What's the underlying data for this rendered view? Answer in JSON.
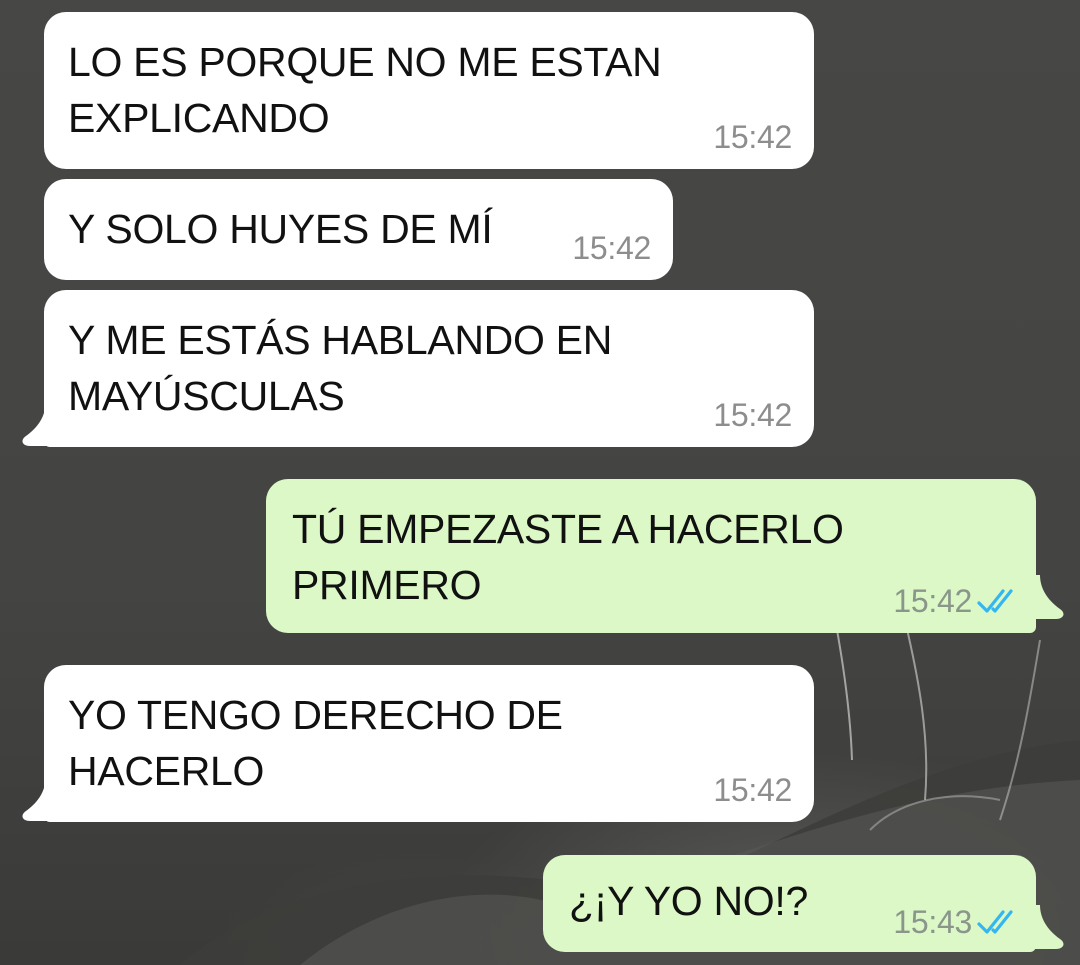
{
  "chat": {
    "messages": [
      {
        "direction": "incoming",
        "text": "LO ES PORQUE NO ME ESTAN\nEXPLICANDO",
        "time": "15:42"
      },
      {
        "direction": "incoming",
        "text": "Y SOLO HUYES DE MÍ",
        "time": "15:42"
      },
      {
        "direction": "incoming",
        "text": "Y ME ESTÁS HABLANDO EN\nMAYÚSCULAS",
        "time": "15:42"
      },
      {
        "direction": "outgoing",
        "text": "TÚ EMPEZASTE A HACERLO\nPRIMERO",
        "time": "15:42",
        "status": "read-double-check-icon"
      },
      {
        "direction": "incoming",
        "text": "YO TENGO DERECHO DE\nHACERLO",
        "time": "15:42"
      },
      {
        "direction": "outgoing",
        "text": "¿¡Y YO NO!?",
        "time": "15:43",
        "status": "read-double-check-icon"
      }
    ]
  },
  "colors": {
    "incoming_bubble": "#ffffff",
    "outgoing_bubble": "#dcf8c6",
    "read_ticks": "#34b7f1",
    "wallpaper": "#454543"
  }
}
